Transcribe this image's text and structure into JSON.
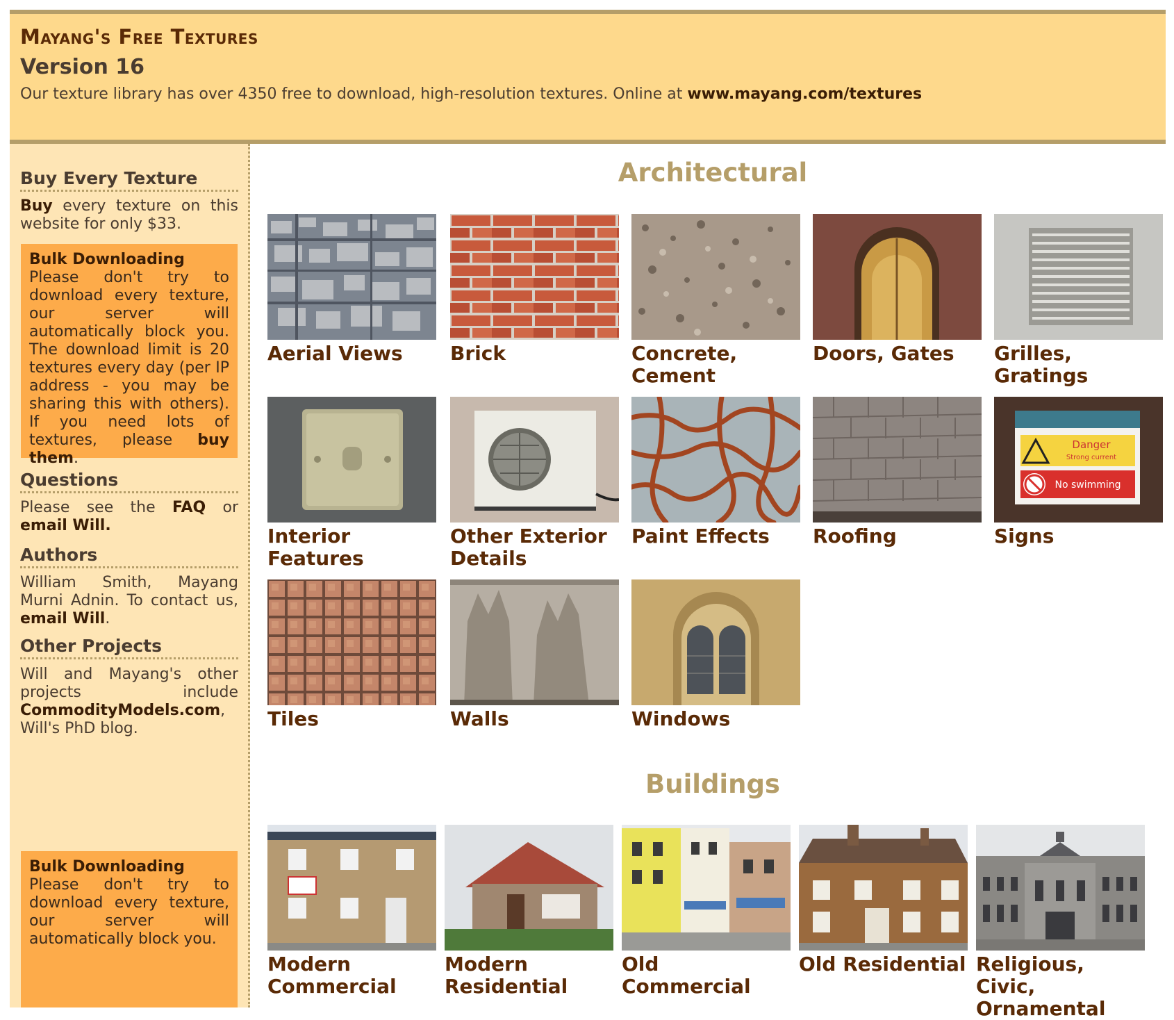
{
  "header": {
    "title": "Mayang's Free Textures",
    "version": "Version 16",
    "desc_prefix": "Our texture library has over 4350 free to download, high-resolution textures. Online at ",
    "desc_link": "www.mayang.com/textures"
  },
  "sidebar": {
    "buy": {
      "heading": "Buy Every Texture",
      "link": "Buy",
      "text": " every texture on this website for only $33."
    },
    "bulk": {
      "title": "Bulk Downloading",
      "text": "Please don't try to download every texture, our server will automatically block you. The download limit is 20 textures every day (per IP address - you may be sharing this with others). If you need lots of textures, please ",
      "link": "buy them",
      "end": "."
    },
    "questions": {
      "heading": "Questions",
      "pre": "Please see the ",
      "faq": "FAQ",
      "mid": " or ",
      "email": "email Will."
    },
    "authors": {
      "heading": "Authors",
      "text": "William Smith, Mayang Murni Adnin. To contact us, ",
      "email": "email Will",
      "end": "."
    },
    "other": {
      "heading": "Other Projects",
      "text": "Will and Mayang's other projects include ",
      "link": "CommodityModels.com",
      "end": ", Will's PhD blog."
    },
    "bulk2": {
      "title": "Bulk Downloading",
      "text": "Please don't try to download every texture, our server will automatically block you."
    }
  },
  "sections": {
    "architectural": {
      "title": "Architectural",
      "items": [
        {
          "label": "Aerial Views",
          "icon": "aerial"
        },
        {
          "label": "Brick",
          "icon": "brick"
        },
        {
          "label": "Concrete, Cement",
          "icon": "concrete"
        },
        {
          "label": "Doors, Gates",
          "icon": "door"
        },
        {
          "label": "Grilles, Gratings",
          "icon": "grille"
        },
        {
          "label": "Interior Features",
          "icon": "switch"
        },
        {
          "label": "Other Exterior Details",
          "icon": "aircon"
        },
        {
          "label": "Paint Effects",
          "icon": "paint"
        },
        {
          "label": "Roofing",
          "icon": "roof"
        },
        {
          "label": "Signs",
          "icon": "sign"
        },
        {
          "label": "Tiles",
          "icon": "tiles"
        },
        {
          "label": "Walls",
          "icon": "wall"
        },
        {
          "label": "Windows",
          "icon": "window"
        }
      ]
    },
    "buildings": {
      "title": "Buildings",
      "items": [
        {
          "label": "Modern Commercial",
          "icon": "modern-commercial"
        },
        {
          "label": "Modern Residential",
          "icon": "modern-residential"
        },
        {
          "label": "Old Commercial",
          "icon": "old-commercial"
        },
        {
          "label": "Old Residential",
          "icon": "old-residential"
        },
        {
          "label": "Religious, Civic, Ornamental",
          "icon": "civic"
        }
      ]
    }
  },
  "sign_text": {
    "danger": "Danger",
    "strong": "Strong current",
    "swim": "No swimming"
  }
}
